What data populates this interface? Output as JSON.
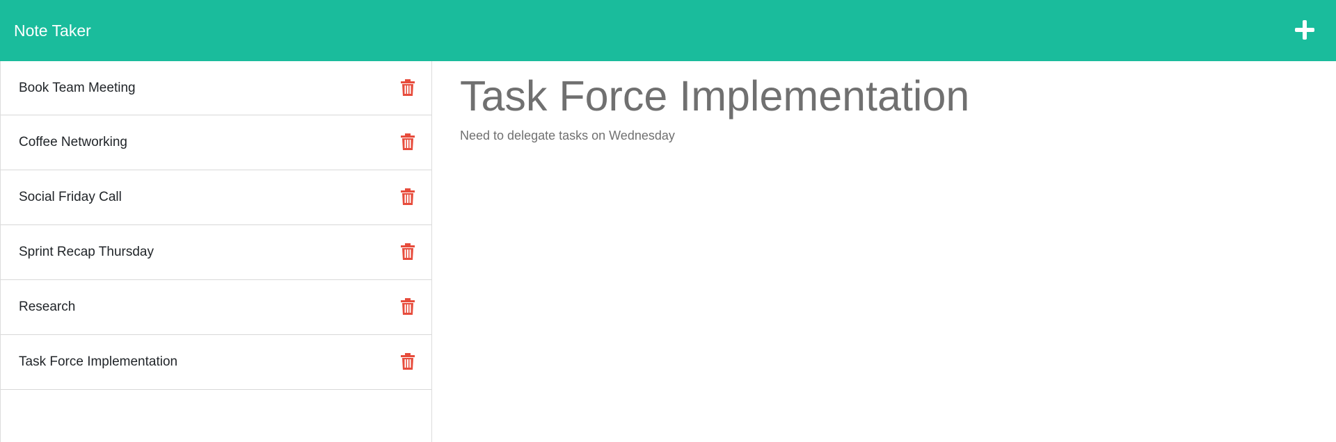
{
  "app": {
    "title": "Note Taker",
    "new_note_icon": "plus-icon",
    "accent_color": "#1abc9c",
    "delete_color": "#e74c3c"
  },
  "notes": [
    {
      "title": "Book Team Meeting"
    },
    {
      "title": "Coffee Networking"
    },
    {
      "title": "Social Friday Call"
    },
    {
      "title": "Sprint Recap Thursday"
    },
    {
      "title": "Research"
    },
    {
      "title": "Task Force Implementation"
    }
  ],
  "active_note": {
    "title": "Task Force Implementation",
    "text": "Need to delegate tasks on Wednesday"
  }
}
